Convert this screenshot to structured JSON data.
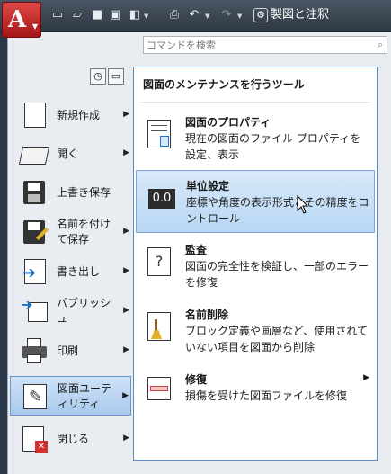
{
  "quick_access": {
    "workspace_label": "製図と注釈",
    "icons": [
      "new-icon",
      "open-icon",
      "save-icon",
      "save-as-icon",
      "plot-icon",
      "print-icon",
      "undo-icon",
      "redo-icon"
    ]
  },
  "search": {
    "placeholder": "コマンドを検索"
  },
  "left_menu": {
    "items": [
      {
        "label": "新規作成",
        "has_arrow": true
      },
      {
        "label": "開く",
        "has_arrow": true
      },
      {
        "label": "上書き保存",
        "has_arrow": false
      },
      {
        "label": "名前を付けて保存",
        "has_arrow": true
      },
      {
        "label": "書き出し",
        "has_arrow": true
      },
      {
        "label": "パブリッシュ",
        "has_arrow": true
      },
      {
        "label": "印刷",
        "has_arrow": true
      },
      {
        "label": "図面ユーティリティ",
        "has_arrow": true,
        "active": true
      },
      {
        "label": "閉じる",
        "has_arrow": true
      }
    ]
  },
  "submenu": {
    "title": "図面のメンテナンスを行うツール",
    "items": [
      {
        "title": "図面のプロパティ",
        "desc": "現在の図面のファイル プロパティを設定、表示"
      },
      {
        "title": "単位設定",
        "desc": "座標や角度の表示形式とその精度をコントロール",
        "badge": "0.0",
        "highlighted": true
      },
      {
        "title": "監査",
        "desc": "図面の完全性を検証し、一部のエラーを修復"
      },
      {
        "title": "名前削除",
        "desc": "ブロック定義や画層など、使用されていない項目を図面から削除"
      },
      {
        "title": "修復",
        "desc": "損傷を受けた図面ファイルを修復",
        "has_arrow": true
      }
    ]
  },
  "colors": {
    "accent": "#c62828",
    "highlight": "#b8d6f3",
    "panel_border": "#5a8ac0"
  }
}
